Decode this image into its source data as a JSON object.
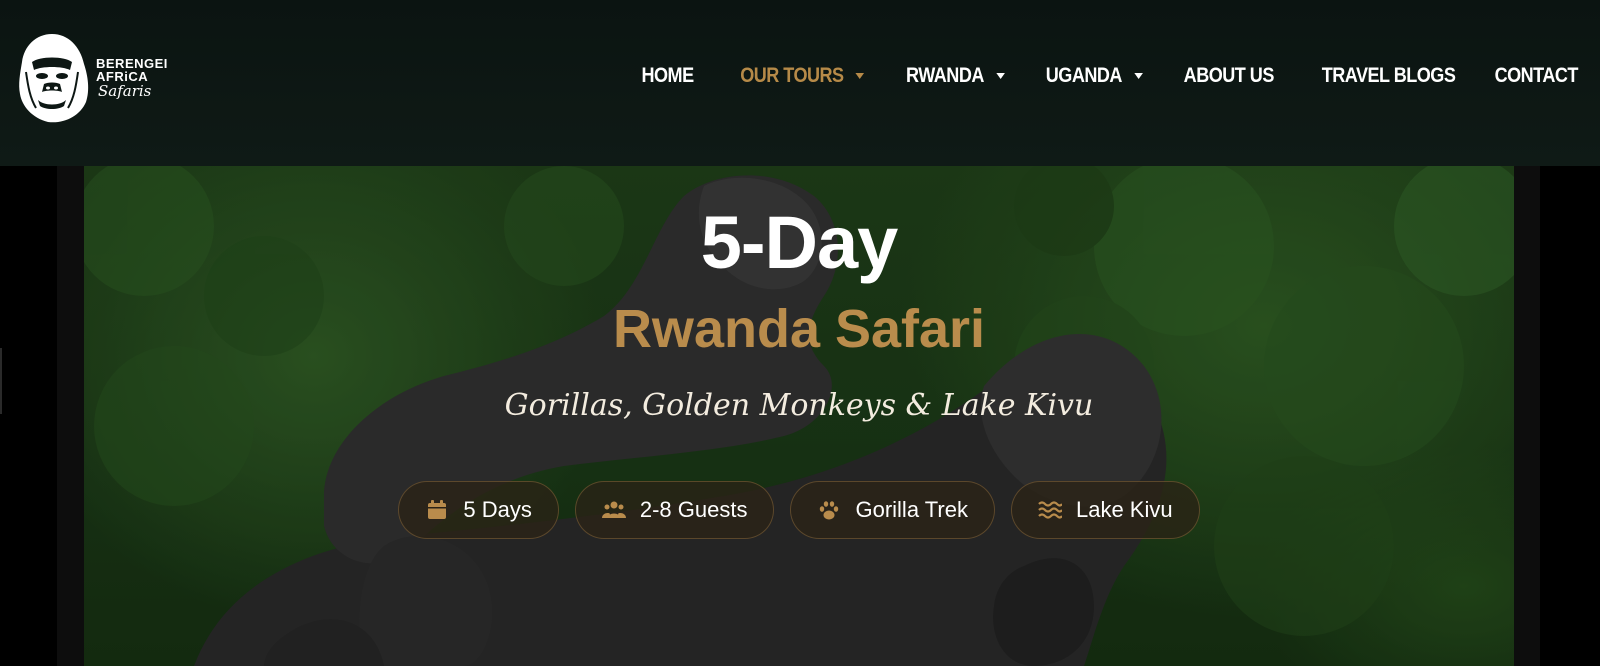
{
  "brand": {
    "logo_line1": "BERENGEI",
    "logo_line2": "AFRiCA",
    "logo_line3": "Safaris"
  },
  "nav": {
    "items": [
      {
        "label": "HOME",
        "has_dropdown": false,
        "active": false
      },
      {
        "label": "OUR TOURS",
        "has_dropdown": true,
        "active": true
      },
      {
        "label": "RWANDA",
        "has_dropdown": true,
        "active": false
      },
      {
        "label": "UGANDA",
        "has_dropdown": true,
        "active": false
      },
      {
        "label": "ABOUT US",
        "has_dropdown": false,
        "active": false
      },
      {
        "label": "TRAVEL BLOGS",
        "has_dropdown": false,
        "active": false
      },
      {
        "label": "CONTACT",
        "has_dropdown": false,
        "active": false
      }
    ]
  },
  "hero": {
    "title": "5-Day",
    "subtitle": "Rwanda Safari",
    "tagline": "Gorillas, Golden Monkeys & Lake Kivu",
    "pills": [
      {
        "icon": "calendar-icon",
        "label": "5 Days"
      },
      {
        "icon": "users-icon",
        "label": "2-8 Guests"
      },
      {
        "icon": "paw-icon",
        "label": "Gorilla Trek"
      },
      {
        "icon": "water-icon",
        "label": "Lake Kivu"
      }
    ]
  },
  "colors": {
    "accent_gold": "#b98c4c",
    "header_bg": "#0d1714",
    "foliage_green": "#2a5220"
  }
}
